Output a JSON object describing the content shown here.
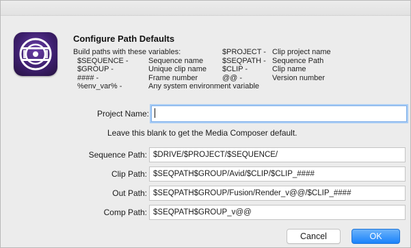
{
  "dialog": {
    "heading": "Configure Path Defaults",
    "intro": "Build paths with these variables:",
    "variables": [
      {
        "name": "$SEQUENCE -",
        "desc": "Sequence name"
      },
      {
        "name": "$GROUP -",
        "desc": "Unique clip name"
      },
      {
        "name": "#### -",
        "desc": "Frame number"
      },
      {
        "name": "%env_var% -",
        "desc": "Any system environment variable"
      },
      {
        "name": "$PROJECT -",
        "desc": "Clip project name"
      },
      {
        "name": "$SEQPATH -",
        "desc": "Sequence Path"
      },
      {
        "name": "$CLIP -",
        "desc": "Clip name"
      },
      {
        "name": "@@ -",
        "desc": "Version number"
      }
    ]
  },
  "form": {
    "project_name_label": "Project Name:",
    "project_name_value": "",
    "note": "Leave this blank to get the Media Composer default.",
    "sequence_path_label": "Sequence Path:",
    "sequence_path_value": "$DRIVE/$PROJECT/$SEQUENCE/",
    "clip_path_label": "Clip Path:",
    "clip_path_value": "$SEQPATH$GROUP/Avid/$CLIP/$CLIP_####",
    "out_path_label": "Out Path:",
    "out_path_value": "$SEQPATH$GROUP/Fusion/Render_v@@/$CLIP_####",
    "comp_path_label": "Comp Path:",
    "comp_path_value": "$SEQPATH$GROUP_v@@"
  },
  "buttons": {
    "cancel_label": "Cancel",
    "ok_label": "OK"
  },
  "colors": {
    "accent": "#1a82fb",
    "focus_ring": "#a9cdf5",
    "icon_purple": "#3d1f6e"
  },
  "icons": {
    "app": "media-composer-app-icon"
  }
}
